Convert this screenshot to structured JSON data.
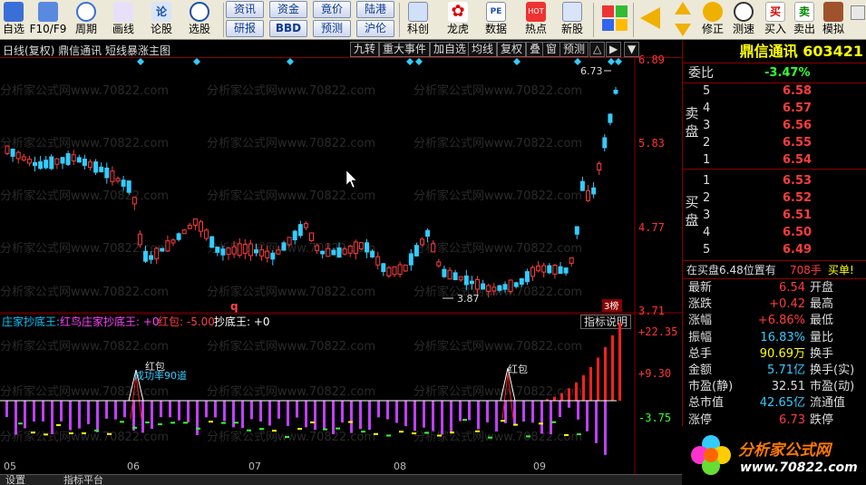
{
  "toolbar": {
    "buttons": [
      {
        "label": "自选",
        "icon": "self-select-icon"
      },
      {
        "label": "F10/F9",
        "icon": "f10-icon"
      },
      {
        "label": "周期",
        "icon": "clock-icon"
      },
      {
        "label": "画线",
        "icon": "pencil-icon"
      },
      {
        "label": "论股",
        "icon": "discuss-icon"
      },
      {
        "label": "选股",
        "icon": "stock-picker-icon"
      }
    ],
    "small_buttons": [
      "资讯",
      "资金",
      "竟价",
      "陆港",
      "研报",
      "BBD",
      "预测",
      "沪伦"
    ],
    "buttons2": [
      {
        "label": "科创",
        "icon": "chart-line-icon"
      },
      {
        "label": "龙虎",
        "icon": "dragon-tiger-icon"
      },
      {
        "label": "数据",
        "icon": "pe-data-icon"
      },
      {
        "label": "热点",
        "icon": "hot-icon"
      },
      {
        "label": "新股",
        "icon": "new-stock-icon"
      }
    ],
    "right_buttons": [
      {
        "label": "修正",
        "icon": "refresh-icon"
      },
      {
        "label": "测速",
        "icon": "speed-clock-icon"
      },
      {
        "label": "买入",
        "icon": "buy-icon",
        "glyph": "买"
      },
      {
        "label": "卖出",
        "icon": "sell-icon",
        "glyph": "卖"
      },
      {
        "label": "模拟",
        "icon": "gavel-icon"
      }
    ]
  },
  "titlebar": {
    "title": "日线(复权)  鼎信通讯 短线暴涨主图",
    "buttons": [
      "九转",
      "重大事件",
      "加自选",
      "均线",
      "复权",
      "叠",
      "窗",
      "预测"
    ]
  },
  "main_chart": {
    "price_labels": [
      "6.89",
      "5.83",
      "4.77",
      "3.71"
    ],
    "high_label": "6.73",
    "low_label": "3.87",
    "q_marker": "q",
    "rank_badge": "3榜",
    "watermark": "分析家公式网www.70822.com"
  },
  "indicator": {
    "name": "庄家抄底王",
    "legend": [
      {
        "text": "庄家抄底王:",
        "color": "#00c8ff"
      },
      {
        "text": "红鸟庄家抄底王: +0",
        "color": "#ff40ff"
      },
      {
        "text": "红包: -5.00",
        "color": "#ff4040"
      },
      {
        "text": "抄底王: +0",
        "color": "#ffffff"
      }
    ],
    "help_button": "指标说明",
    "axis_labels": [
      "+22.35",
      "+9.30",
      "-3.75"
    ],
    "annotations": {
      "hongbao": "红包",
      "success": "成功率90道"
    },
    "month_labels": [
      "05",
      "06",
      "07",
      "08",
      "09"
    ]
  },
  "panel": {
    "stock_title": "鼎信通讯 603421",
    "weibi_label": "委比",
    "weibi_value": "-3.47%",
    "sell_side": "卖盘",
    "buy_side": "买盘",
    "sell_orders": [
      {
        "level": "5",
        "price": "6.58"
      },
      {
        "level": "4",
        "price": "6.57"
      },
      {
        "level": "3",
        "price": "6.56"
      },
      {
        "level": "2",
        "price": "6.55"
      },
      {
        "level": "1",
        "price": "6.54"
      }
    ],
    "buy_orders": [
      {
        "level": "1",
        "price": "6.53"
      },
      {
        "level": "2",
        "price": "6.52"
      },
      {
        "level": "3",
        "price": "6.51"
      },
      {
        "level": "4",
        "price": "6.50"
      },
      {
        "level": "5",
        "price": "6.49"
      }
    ],
    "notice": {
      "text": "在买盘6.48位置有",
      "volume": "708手",
      "action": "买单!"
    },
    "stats": [
      {
        "k": "最新",
        "v": "6.54",
        "vc": "red",
        "k2": "开盘"
      },
      {
        "k": "涨跌",
        "v": "+0.42",
        "vc": "red",
        "k2": "最高"
      },
      {
        "k": "涨幅",
        "v": "+6.86%",
        "vc": "red",
        "k2": "最低"
      },
      {
        "k": "振幅",
        "v": "16.83%",
        "vc": "cyan",
        "k2": "量比"
      },
      {
        "k": "总手",
        "v": "90.69万",
        "vc": "yellow",
        "k2": "换手"
      },
      {
        "k": "金额",
        "v": "5.71亿",
        "vc": "cyan",
        "k2": "换手(实)"
      },
      {
        "k": "市盈(静)",
        "v": "32.51",
        "vc": "white",
        "k2": "市盈(动)"
      },
      {
        "k": "总市值",
        "v": "42.65亿",
        "vc": "cyan",
        "k2": "流通值"
      },
      {
        "k": "涨停",
        "v": "6.73",
        "vc": "red",
        "k2": "跌停"
      }
    ]
  },
  "bottom_tabs": [
    "设置",
    "指标平台"
  ],
  "logo": {
    "brand": "分析家公式网",
    "url": "www.70822.com"
  }
}
